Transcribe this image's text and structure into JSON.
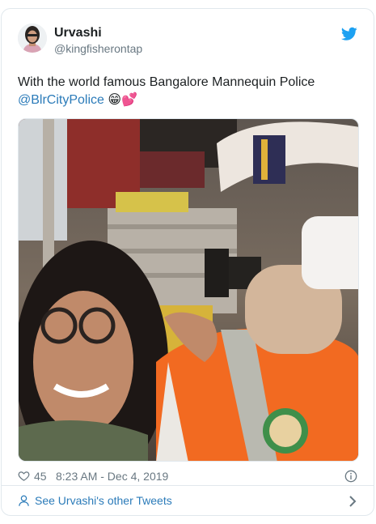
{
  "author": {
    "display_name": "Urvashi",
    "handle": "@kingfisherontap"
  },
  "tweet": {
    "text_before": "With the world famous Bangalore Mannequin Police ",
    "mention": "@BlrCityPolice",
    "emoji": "😁💕"
  },
  "meta": {
    "likes": "45",
    "timestamp": "8:23 AM - Dec 4, 2019"
  },
  "footer": {
    "label": "See Urvashi's other Tweets"
  },
  "colors": {
    "link": "#2b7bb9",
    "twitter_blue": "#1da1f2",
    "muted": "#697882",
    "border": "#e1e8ed"
  },
  "icons": [
    "twitter-bird-icon",
    "heart-icon",
    "info-icon",
    "user-icon",
    "chevron-right-icon"
  ]
}
